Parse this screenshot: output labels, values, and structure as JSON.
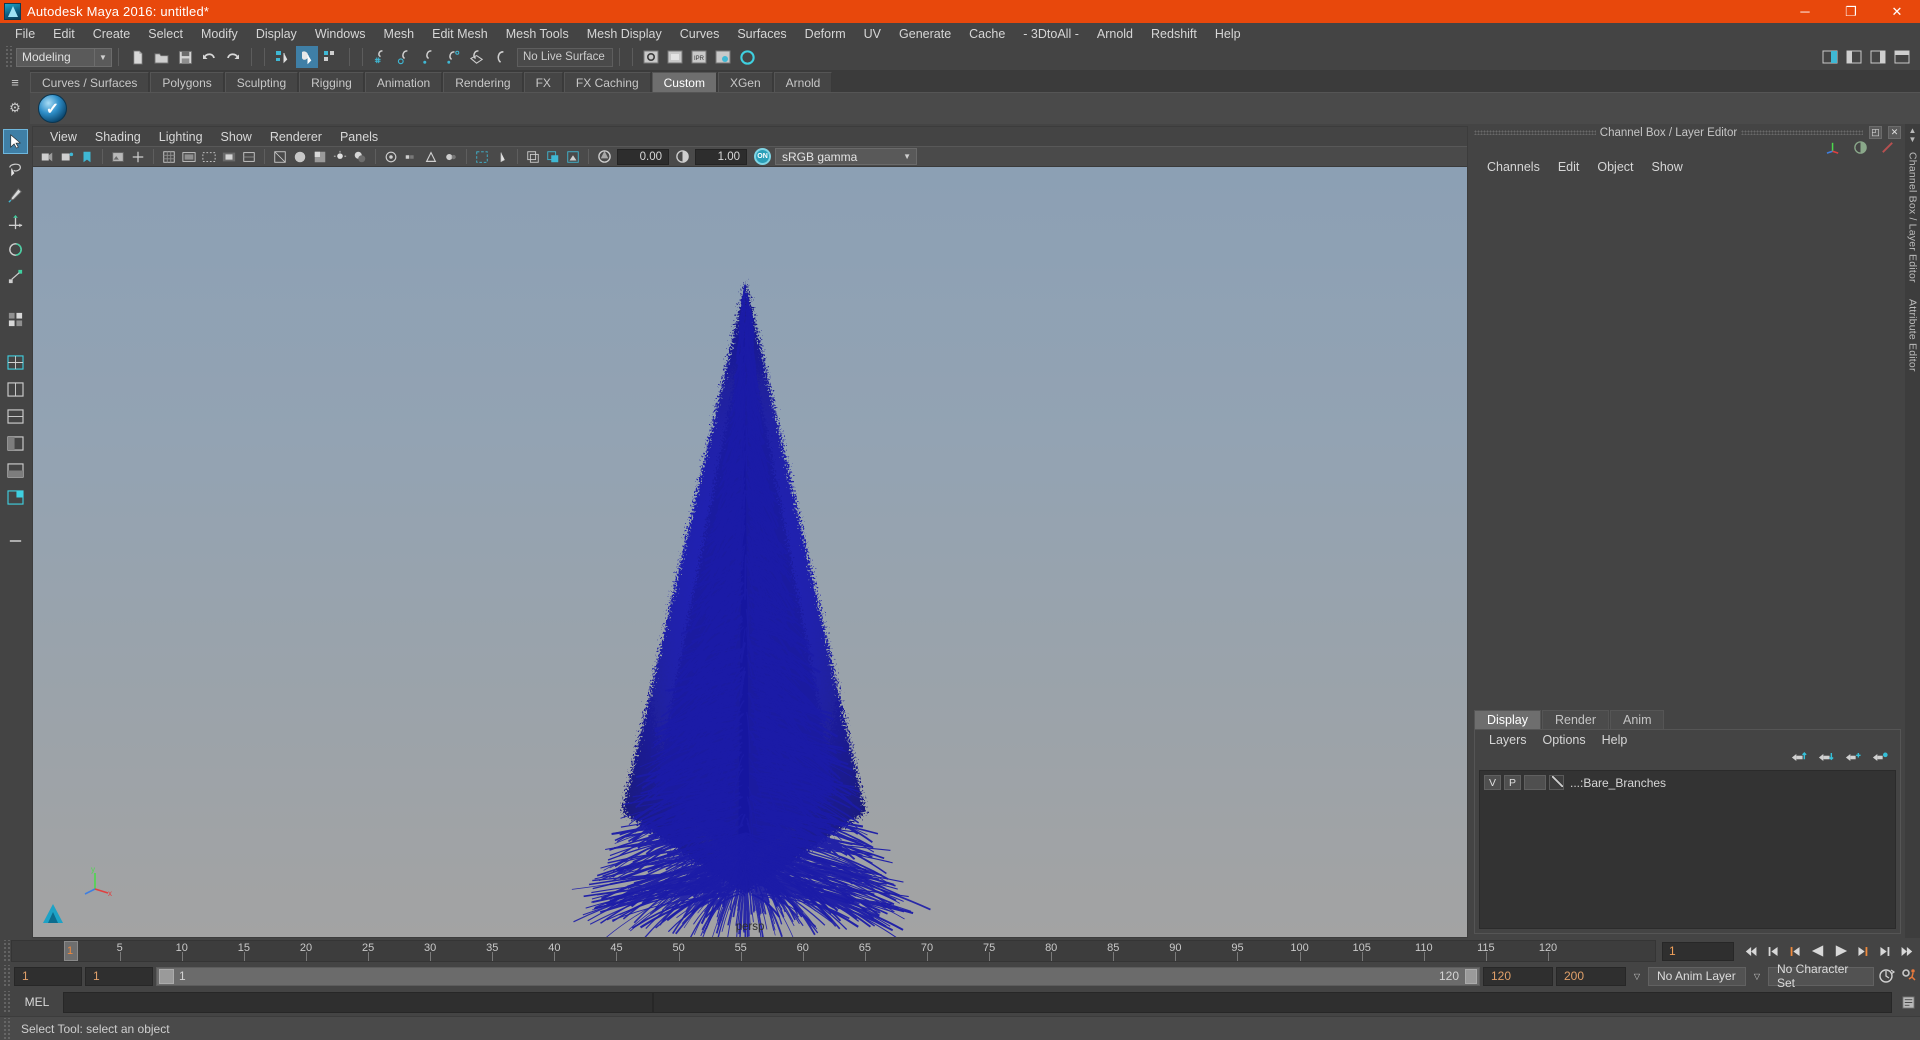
{
  "window": {
    "title": "Autodesk Maya 2016: untitled*",
    "logo_icon": "maya-logo-icon",
    "minimize_label": "─",
    "maximize_label": "❐",
    "close_label": "✕"
  },
  "menubar": {
    "items": [
      {
        "label": "File"
      },
      {
        "label": "Edit"
      },
      {
        "label": "Create"
      },
      {
        "label": "Select"
      },
      {
        "label": "Modify"
      },
      {
        "label": "Display"
      },
      {
        "label": "Windows"
      },
      {
        "label": "Mesh"
      },
      {
        "label": "Edit Mesh"
      },
      {
        "label": "Mesh Tools"
      },
      {
        "label": "Mesh Display"
      },
      {
        "label": "Curves"
      },
      {
        "label": "Surfaces"
      },
      {
        "label": "Deform"
      },
      {
        "label": "UV"
      },
      {
        "label": "Generate"
      },
      {
        "label": "Cache"
      },
      {
        "label": "- 3DtoAll -"
      },
      {
        "label": "Arnold"
      },
      {
        "label": "Redshift"
      },
      {
        "label": "Help"
      }
    ]
  },
  "statusline": {
    "menuset_value": "Modeling",
    "menuset_arrow": "▼",
    "live_surface_value": "No Live Surface",
    "icons": [
      {
        "name": "new-scene-icon"
      },
      {
        "name": "open-scene-icon"
      },
      {
        "name": "save-scene-icon"
      },
      {
        "name": "undo-icon"
      },
      {
        "name": "redo-icon"
      },
      {
        "name": "select-by-hierarchy-icon"
      },
      {
        "name": "select-by-object-icon"
      },
      {
        "name": "select-by-component-icon"
      },
      {
        "name": "snap-to-grid-icon"
      },
      {
        "name": "snap-to-curve-icon"
      },
      {
        "name": "snap-to-point-icon"
      },
      {
        "name": "snap-to-projected-center-icon"
      },
      {
        "name": "snap-to-view-plane-icon"
      },
      {
        "name": "make-live-icon"
      },
      {
        "name": "render-current-frame-icon"
      },
      {
        "name": "render-sequence-icon"
      },
      {
        "name": "ipr-render-icon"
      },
      {
        "name": "render-settings-icon"
      },
      {
        "name": "hypershade-icon"
      }
    ],
    "right_icons": [
      {
        "name": "show-hide-attribute-editor-icon"
      },
      {
        "name": "show-hide-tool-settings-icon"
      },
      {
        "name": "show-hide-channel-box-icon"
      },
      {
        "name": "sidebar-toggle-icon"
      }
    ]
  },
  "shelf": {
    "tabs": [
      {
        "label": "Curves / Surfaces",
        "active": false
      },
      {
        "label": "Polygons",
        "active": false
      },
      {
        "label": "Sculpting",
        "active": false
      },
      {
        "label": "Rigging",
        "active": false
      },
      {
        "label": "Animation",
        "active": false
      },
      {
        "label": "Rendering",
        "active": false
      },
      {
        "label": "FX",
        "active": false
      },
      {
        "label": "FX Caching",
        "active": false
      },
      {
        "label": "Custom",
        "active": true
      },
      {
        "label": "XGen",
        "active": false
      },
      {
        "label": "Arnold",
        "active": false
      }
    ],
    "left_icons": [
      {
        "name": "shelf-tab-menu-icon",
        "glyph": "≡"
      },
      {
        "name": "shelf-options-gear-icon",
        "glyph": "⚙"
      }
    ],
    "item_label": "✓",
    "item_name": "custom-shelf-button"
  },
  "toolbox": {
    "tools": [
      {
        "name": "select-tool",
        "selected": true
      },
      {
        "name": "lasso-select-tool",
        "selected": false
      },
      {
        "name": "paint-select-tool",
        "selected": false
      },
      {
        "name": "move-tool",
        "selected": false
      },
      {
        "name": "rotate-tool",
        "selected": false
      },
      {
        "name": "scale-tool",
        "selected": false
      },
      {
        "name": "last-tool-used",
        "selected": false
      },
      {
        "name": "single-perspective-layout",
        "selected": false
      },
      {
        "name": "four-view-layout",
        "selected": false
      },
      {
        "name": "persp-outliner-layout",
        "selected": false
      },
      {
        "name": "persp-graph-layout",
        "selected": false
      },
      {
        "name": "persp-hypershade-layout",
        "selected": false
      },
      {
        "name": "two-pane-layout",
        "selected": false
      },
      {
        "name": "more-layouts",
        "selected": false
      }
    ]
  },
  "viewport": {
    "menus": [
      {
        "label": "View"
      },
      {
        "label": "Shading"
      },
      {
        "label": "Lighting"
      },
      {
        "label": "Show"
      },
      {
        "label": "Renderer"
      },
      {
        "label": "Panels"
      }
    ],
    "camera_label": "persp",
    "exposure_value": "0.00",
    "gamma_value": "1.00",
    "color_management_value": "sRGB gamma",
    "color_management_arrow": "▼",
    "color_management_toggle": "ON",
    "toolbar_icons": [
      {
        "name": "select-camera-icon"
      },
      {
        "name": "camera-attributes-icon"
      },
      {
        "name": "bookmark-icon"
      },
      {
        "name": "image-plane-icon"
      },
      {
        "name": "two-d-pan-zoom-icon"
      },
      {
        "name": "grid-toggle-icon"
      },
      {
        "name": "film-gate-icon"
      },
      {
        "name": "resolution-gate-icon"
      },
      {
        "name": "gate-mask-icon"
      },
      {
        "name": "film-origin-icon"
      },
      {
        "name": "exposure-icon"
      },
      {
        "name": "gamma-icon"
      },
      {
        "name": "wireframe-shading-icon"
      },
      {
        "name": "smooth-shade-all-icon"
      },
      {
        "name": "shade-using-textures-icon"
      },
      {
        "name": "use-default-lighting-icon"
      },
      {
        "name": "shadows-icon"
      },
      {
        "name": "screen-space-ao-icon"
      },
      {
        "name": "motion-blur-icon"
      },
      {
        "name": "multisample-aa-icon"
      },
      {
        "name": "depth-of-field-icon"
      },
      {
        "name": "isolate-select-icon"
      },
      {
        "name": "xray-mode-icon"
      },
      {
        "name": "xray-joints-icon"
      },
      {
        "name": "xray-active-icon"
      }
    ],
    "gizmo_axes": [
      "y",
      "z",
      "x"
    ],
    "scene_object_color": "#1c1ca8"
  },
  "channel_box": {
    "panel_title": "Channel Box / Layer Editor",
    "float_button": "◰",
    "close_button": "✕",
    "menus": [
      {
        "label": "Channels"
      },
      {
        "label": "Edit"
      },
      {
        "label": "Object"
      },
      {
        "label": "Show"
      }
    ],
    "header_icons": [
      {
        "name": "channel-box-axis-icon"
      },
      {
        "name": "attribute-editor-toggle-icon"
      },
      {
        "name": "anim-layer-toggle-icon"
      }
    ]
  },
  "layer_editor": {
    "tabs": [
      {
        "label": "Display",
        "active": true
      },
      {
        "label": "Render",
        "active": false
      },
      {
        "label": "Anim",
        "active": false
      }
    ],
    "menus": [
      {
        "label": "Layers"
      },
      {
        "label": "Options"
      },
      {
        "label": "Help"
      }
    ],
    "toolbar_icons": [
      {
        "name": "move-layer-up-icon"
      },
      {
        "name": "move-layer-down-icon"
      },
      {
        "name": "new-layer-icon"
      },
      {
        "name": "new-layer-from-selected-icon"
      }
    ],
    "layers": [
      {
        "visibility": "V",
        "playback": "P",
        "state": "",
        "name": "...:Bare_Branches"
      }
    ]
  },
  "right_dock_sidebar": {
    "tabs": [
      {
        "label": "Channel Box / Layer Editor"
      },
      {
        "label": "Attribute Editor"
      }
    ],
    "scroll_up": "▲",
    "scroll_down": "▼"
  },
  "time_slider": {
    "start_tick": 1,
    "end_tick": 120,
    "tick_labels": [
      5,
      10,
      15,
      20,
      25,
      30,
      35,
      40,
      45,
      50,
      55,
      60,
      65,
      70,
      75,
      80,
      85,
      90,
      95,
      100,
      105,
      110,
      115,
      120
    ],
    "current_frame_marker": "1",
    "current_frame_field": "1",
    "playback_buttons": [
      {
        "name": "go-to-start-button",
        "glyph": "⏮"
      },
      {
        "name": "step-back-frame-button",
        "glyph": "◀|"
      },
      {
        "name": "step-back-key-button",
        "glyph": "◀"
      },
      {
        "name": "play-backwards-button",
        "glyph": "◀"
      },
      {
        "name": "play-forwards-button",
        "glyph": "▶"
      },
      {
        "name": "step-forward-key-button",
        "glyph": "▶"
      },
      {
        "name": "step-forward-frame-button",
        "glyph": "|▶"
      },
      {
        "name": "go-to-end-button",
        "glyph": "⏭"
      }
    ]
  },
  "range_slider": {
    "anim_start": "1",
    "range_start": "1",
    "range_bar_start_label": "1",
    "range_bar_end_label": "120",
    "range_end": "120",
    "anim_end": "200",
    "anim_layer_value": "No Anim Layer",
    "character_set_value": "No Character Set",
    "dropdown_arrow": "▽",
    "auto_key_icon": "auto-keyframe-icon",
    "anim_prefs_icon": "animation-preferences-icon"
  },
  "command_line": {
    "language_label": "MEL",
    "input_value": "",
    "input_placeholder": "",
    "script_editor_icon": "script-editor-icon"
  },
  "help_line": {
    "text": "Select Tool: select an object"
  },
  "colors": {
    "accent_orange": "#e8480c",
    "accent_blue": "#3f7fa6",
    "panel_bg": "#444444",
    "field_bg": "#2f2f2f",
    "tree_color": "#1c1ca8"
  }
}
